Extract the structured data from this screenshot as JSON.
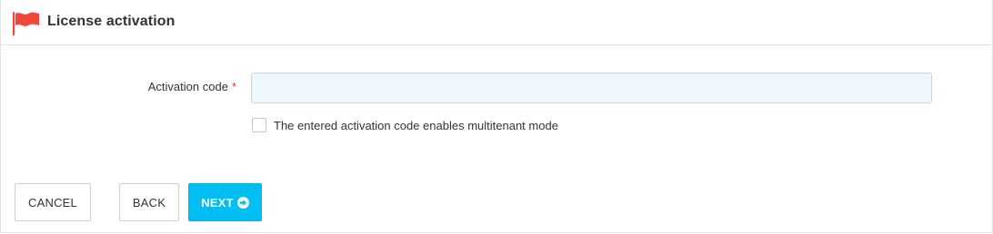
{
  "header": {
    "title": "License activation",
    "icon": "flag-icon",
    "icon_color": "#f0473d"
  },
  "form": {
    "activation_code_label": "Activation code",
    "required_marker": "*",
    "activation_code_value": "",
    "multitenant_checkbox_label": "The entered activation code enables multitenant mode",
    "multitenant_checked": false
  },
  "actions": {
    "cancel_label": "CANCEL",
    "back_label": "BACK",
    "next_label": "NEXT",
    "next_icon": "arrow-circle-right-icon",
    "primary_color": "#00bdf2"
  }
}
